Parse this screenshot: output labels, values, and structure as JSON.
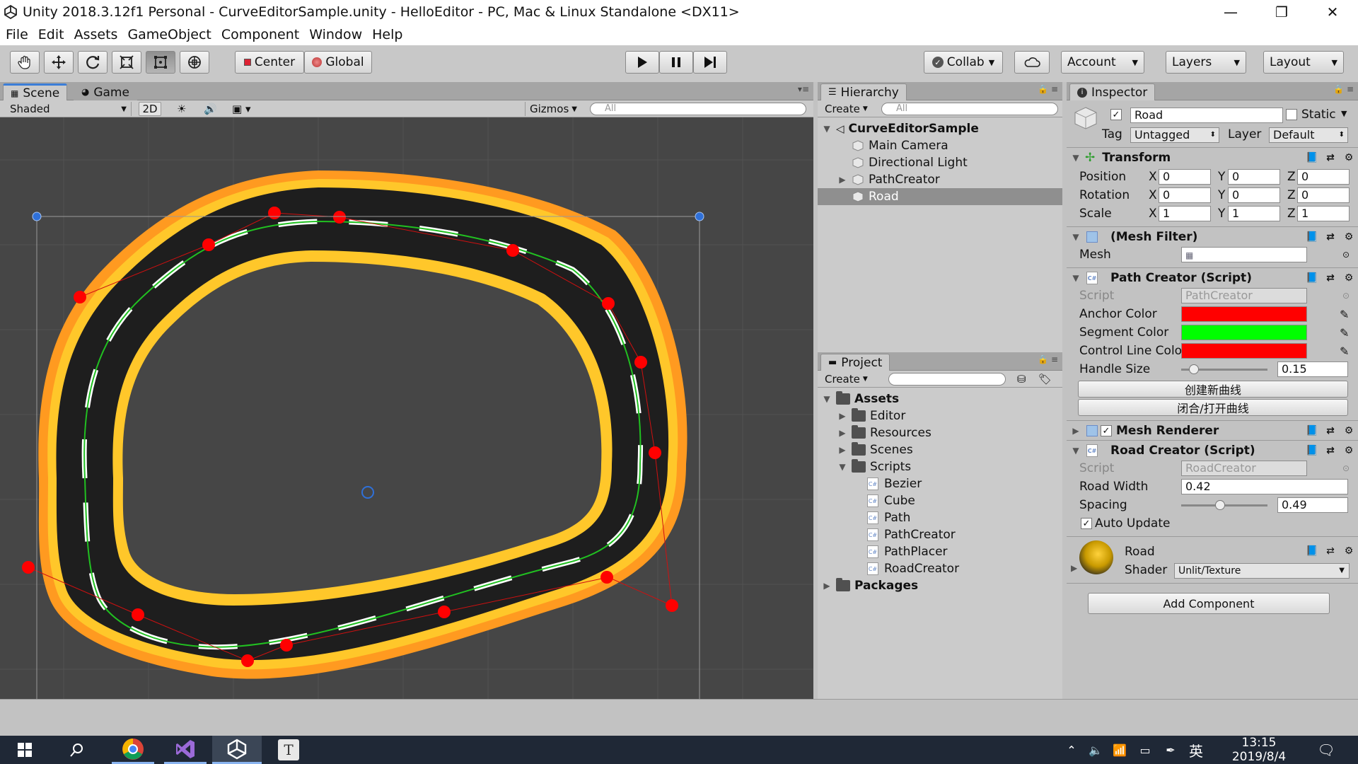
{
  "window": {
    "title": "Unity 2018.3.12f1 Personal - CurveEditorSample.unity - HelloEditor - PC, Mac & Linux Standalone <DX11>",
    "minimize": "—",
    "maximize": "❐",
    "close": "✕"
  },
  "menu": [
    "File",
    "Edit",
    "Assets",
    "GameObject",
    "Component",
    "Window",
    "Help"
  ],
  "toolbar": {
    "tools": [
      "hand-tool-icon",
      "move-tool-icon",
      "rotate-tool-icon",
      "scale-tool-icon",
      "rect-tool-icon",
      "transform-tool-icon"
    ],
    "pivot": "Center",
    "space": "Global",
    "collab": "Collab",
    "account": "Account",
    "layers": "Layers",
    "layout": "Layout"
  },
  "scene": {
    "tab_scene": "Scene",
    "tab_game": "Game",
    "shading": "Shaded",
    "mode_2d": "2D",
    "gizmos": "Gizmos",
    "search_placeholder": "All"
  },
  "hierarchy": {
    "tab": "Hierarchy",
    "create": "Create",
    "search_placeholder": "All",
    "scene_name": "CurveEditorSample",
    "items": [
      "Main Camera",
      "Directional Light",
      "PathCreator",
      "Road"
    ],
    "selected": "Road"
  },
  "project": {
    "tab": "Project",
    "create": "Create",
    "root": "Assets",
    "folders": [
      "Editor",
      "Resources",
      "Scenes",
      "Scripts"
    ],
    "scripts": [
      "Bezier",
      "Cube",
      "Path",
      "PathCreator",
      "PathPlacer",
      "RoadCreator"
    ],
    "packages": "Packages"
  },
  "inspector": {
    "tab": "Inspector",
    "object_name": "Road",
    "static_label": "Static",
    "tag_label": "Tag",
    "tag_value": "Untagged",
    "layer_label": "Layer",
    "layer_value": "Default",
    "transform": {
      "title": "Transform",
      "position_label": "Position",
      "rotation_label": "Rotation",
      "scale_label": "Scale",
      "position": [
        "0",
        "0",
        "0"
      ],
      "rotation": [
        "0",
        "0",
        "0"
      ],
      "scale": [
        "1",
        "1",
        "1"
      ]
    },
    "mesh_filter": {
      "title": "(Mesh Filter)",
      "mesh_label": "Mesh"
    },
    "path_creator": {
      "title": "Path Creator (Script)",
      "script_label": "Script",
      "script_value": "PathCreator",
      "anchor_label": "Anchor Color",
      "anchor_color": "#ff0000",
      "segment_label": "Segment Color",
      "segment_color": "#00ff00",
      "control_label": "Control Line Color",
      "control_color": "#ff0000",
      "handle_label": "Handle Size",
      "handle_value": "0.15",
      "handle_fraction": 0.15,
      "btn_create": "创建新曲线",
      "btn_toggle": "闭合/打开曲线"
    },
    "mesh_renderer": {
      "title": "Mesh Renderer"
    },
    "road_creator": {
      "title": "Road Creator (Script)",
      "script_label": "Script",
      "script_value": "RoadCreator",
      "width_label": "Road Width",
      "width_value": "0.42",
      "spacing_label": "Spacing",
      "spacing_value": "0.49",
      "spacing_fraction": 0.45,
      "auto_update_label": "Auto Update"
    },
    "material": {
      "name": "Road",
      "shader_label": "Shader",
      "shader_value": "Unlit/Texture"
    },
    "add_component": "Add Component"
  },
  "taskbar": {
    "time": "13:15",
    "date": "2019/8/4",
    "ime": "英"
  }
}
